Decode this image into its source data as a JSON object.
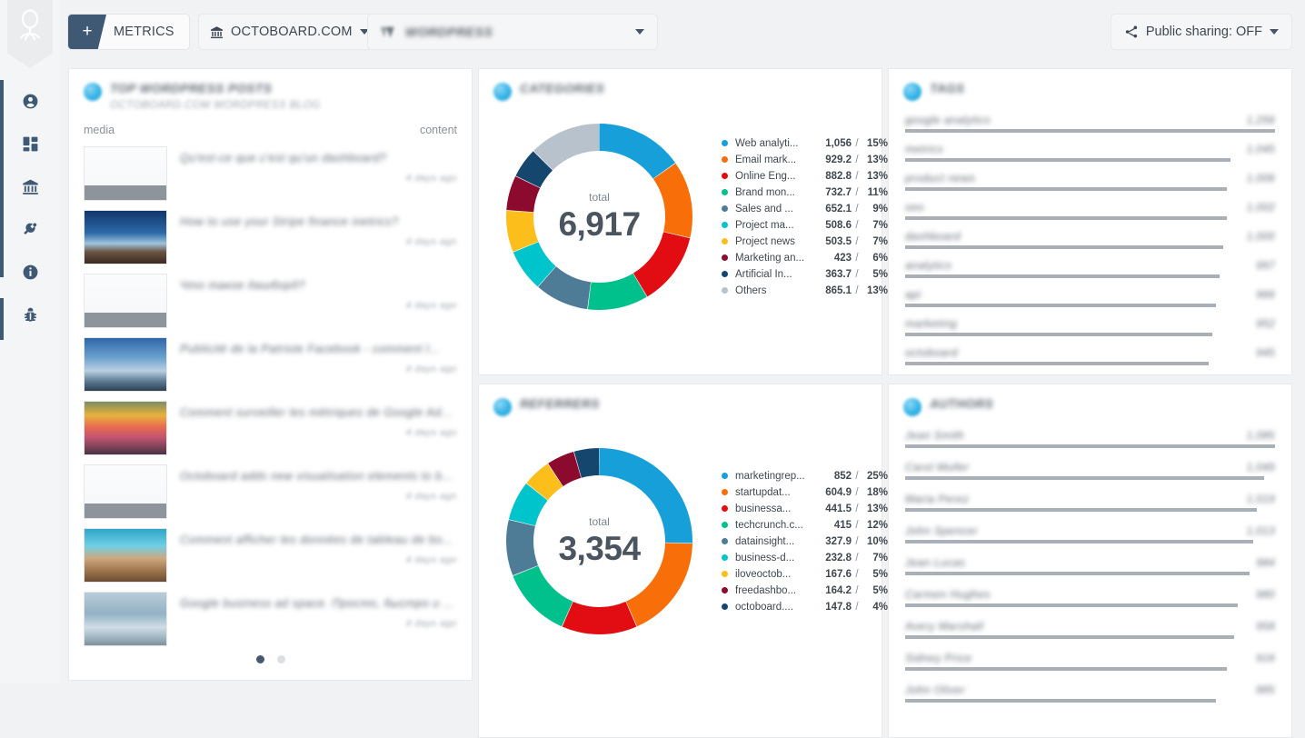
{
  "app": {
    "logo_icon": "octoboard-logo-icon",
    "background": "#f1f2f4",
    "accent": "#3f5873"
  },
  "sidebar": {
    "items": [
      {
        "icon": "user-circle-icon",
        "name": "account"
      },
      {
        "icon": "dashboard-grid-icon",
        "name": "dashboards"
      },
      {
        "icon": "bank-icon",
        "name": "clients"
      },
      {
        "icon": "plug-icon",
        "name": "integrations"
      },
      {
        "icon": "info-circle-icon",
        "name": "info"
      },
      {
        "icon": "bug-icon",
        "name": "report-bug"
      }
    ]
  },
  "toolbar": {
    "add_icon": "plus-icon",
    "metrics_label": "METRICS",
    "account_icon": "bank-icon",
    "account_label": "OCTOBOARD.COM",
    "source_label": "WORDPRESS",
    "source_icon": "wordpress-icon",
    "share_icon": "share-icon",
    "share_label": "Public sharing: OFF",
    "caret_icon": "chevron-down-icon"
  },
  "cards": {
    "posts": {
      "title": "TOP WORDPRESS POSTS",
      "subtitle": "OCTOBOARD.COM WORDPRESS BLOG",
      "col_media": "media",
      "col_content": "content",
      "rows": [
        {
          "title": "Qu'est-ce que c'est qu'un dashboard?",
          "time": "4 days ago",
          "thumb": "dashboard-screenshot"
        },
        {
          "title": "How to use your Stripe finance metrics?",
          "time": "4 days ago",
          "thumb": "night-sky-photo"
        },
        {
          "title": "Что такое дашборд?",
          "time": "4 days ago",
          "thumb": "dashboard-screenshot"
        },
        {
          "title": "Publicité de la Patriote Facebook - comment l...",
          "time": "4 days ago",
          "thumb": "clouds-photo"
        },
        {
          "title": "Comment surveiller les métriques de Google Ad...",
          "time": "4 days ago",
          "thumb": "sunset-mountains-photo"
        },
        {
          "title": "Octoboard adds new visualisation elements to b...",
          "time": "4 days ago",
          "thumb": "dashboard-screenshot"
        },
        {
          "title": "Comment afficher les données de tableau de bo...",
          "time": "4 days ago",
          "thumb": "desert-beach-photo"
        },
        {
          "title": "Google business ad space. Просто, быстро и ...",
          "time": "4 days ago",
          "thumb": "iceberg-photo"
        }
      ],
      "pagination": {
        "pages": 2,
        "active": 1
      }
    },
    "categories": {
      "title": "CATEGORIES"
    },
    "referrers": {
      "title": "REFERRERS"
    },
    "tags": {
      "title": "TAGS",
      "rows": [
        {
          "label": "google analytics",
          "value": "1,256",
          "pct": 100
        },
        {
          "label": "metrics",
          "value": "1,045",
          "pct": 88
        },
        {
          "label": "product news",
          "value": "1,006",
          "pct": 87
        },
        {
          "label": "seo",
          "value": "1,002",
          "pct": 87
        },
        {
          "label": "dashboard",
          "value": "1,000",
          "pct": 86
        },
        {
          "label": "analytics",
          "value": "997",
          "pct": 85
        },
        {
          "label": "api",
          "value": "966",
          "pct": 84
        },
        {
          "label": "marketing",
          "value": "952",
          "pct": 83
        },
        {
          "label": "octoboard",
          "value": "945",
          "pct": 82
        }
      ]
    },
    "authors": {
      "title": "AUTHORS",
      "rows": [
        {
          "label": "Jean Smith",
          "value": "1,085",
          "pct": 100
        },
        {
          "label": "Carol Muller",
          "value": "1,049",
          "pct": 97
        },
        {
          "label": "Maria Perez",
          "value": "1,019",
          "pct": 95
        },
        {
          "label": "John Spencer",
          "value": "1,013",
          "pct": 94
        },
        {
          "label": "Jean Lucas",
          "value": "984",
          "pct": 93
        },
        {
          "label": "Carmen Hughes",
          "value": "980",
          "pct": 90
        },
        {
          "label": "Avery Marshall",
          "value": "958",
          "pct": 89
        },
        {
          "label": "Sidney Price",
          "value": "916",
          "pct": 87
        },
        {
          "label": "John Oliver",
          "value": "885",
          "pct": 84
        }
      ]
    }
  },
  "chart_data": [
    {
      "type": "pie",
      "title": "CATEGORIES",
      "total_label": "total",
      "total": "6,917",
      "legend_position": "right",
      "categories": [
        "Web analyti...",
        "Email mark...",
        "Online Eng...",
        "Brand mon...",
        "Sales and ...",
        "Project ma...",
        "Project news",
        "Marketing an...",
        "Artificial In...",
        "Others"
      ],
      "values": [
        1056,
        929.2,
        882.8,
        732.7,
        652.1,
        508.6,
        503.5,
        423,
        363.7,
        865.1
      ],
      "value_labels": [
        "1,056",
        "929.2",
        "882.8",
        "732.7",
        "652.1",
        "508.6",
        "503.5",
        "423",
        "363.7",
        "865.1"
      ],
      "percents": [
        "15%",
        "13%",
        "13%",
        "11%",
        "9%",
        "7%",
        "7%",
        "6%",
        "5%",
        "13%"
      ],
      "colors": [
        "#169fd8",
        "#f86e08",
        "#e20d12",
        "#00c08b",
        "#4e7c96",
        "#00c4cc",
        "#fcbe1b",
        "#8c0a2e",
        "#14466e",
        "#b8c2cc"
      ]
    },
    {
      "type": "pie",
      "title": "REFERRERS",
      "total_label": "total",
      "total": "3,354",
      "legend_position": "right",
      "categories": [
        "marketingrep...",
        "startupdat...",
        "businessa...",
        "techcrunch.c...",
        "datainsight...",
        "business-d...",
        "iloveoctob...",
        "freedashbo...",
        "octoboard...."
      ],
      "values": [
        852,
        604.9,
        441.5,
        415,
        327.9,
        232.8,
        167.6,
        164.2,
        147.8
      ],
      "value_labels": [
        "852",
        "604.9",
        "441.5",
        "415",
        "327.9",
        "232.8",
        "167.6",
        "164.2",
        "147.8"
      ],
      "percents": [
        "25%",
        "18%",
        "13%",
        "12%",
        "10%",
        "7%",
        "5%",
        "5%",
        "4%"
      ],
      "colors": [
        "#169fd8",
        "#f86e08",
        "#e20d12",
        "#00c08b",
        "#4e7c96",
        "#00c4cc",
        "#fcbe1b",
        "#8c0a2e",
        "#14466e"
      ]
    }
  ]
}
